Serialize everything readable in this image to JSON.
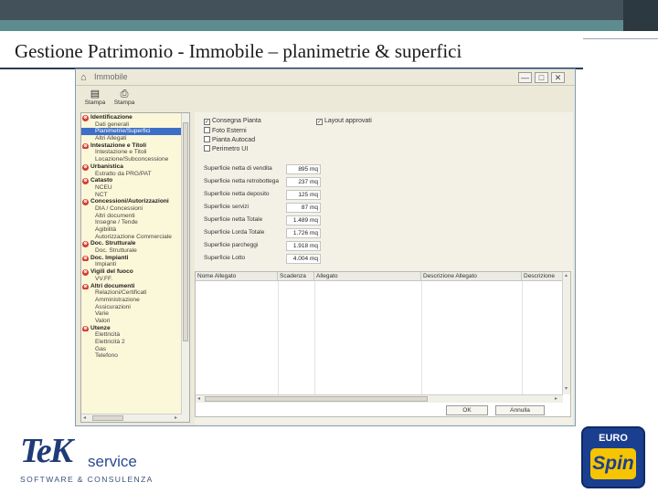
{
  "slide": {
    "title": "Gestione Patrimonio - Immobile – planimetrie & superfici"
  },
  "window": {
    "title": "Immobile",
    "controls": {
      "minimize": "—",
      "maximize": "□",
      "close": "✕"
    }
  },
  "toolbar": {
    "items": [
      {
        "label": "Stampa",
        "icon": "printer-icon"
      },
      {
        "label": "Stampa",
        "icon": "print-preview-icon"
      }
    ]
  },
  "tree": {
    "items": [
      {
        "label": "Identificazione",
        "type": "category"
      },
      {
        "label": "Dati generali",
        "type": "child"
      },
      {
        "label": "Planimetrie/Superfici",
        "type": "child",
        "selected": true
      },
      {
        "label": "Altri Allegati",
        "type": "child"
      },
      {
        "label": "Intestazione e Titoli",
        "type": "category"
      },
      {
        "label": "Intestazione e Titoli",
        "type": "child"
      },
      {
        "label": "Locazione/Subconcessione",
        "type": "child"
      },
      {
        "label": "Urbanistica",
        "type": "category"
      },
      {
        "label": "Estratto da PRG/PAT",
        "type": "child"
      },
      {
        "label": "Catasto",
        "type": "category"
      },
      {
        "label": "NCEU",
        "type": "child"
      },
      {
        "label": "NCT",
        "type": "child"
      },
      {
        "label": "Concessioni/Autorizzazioni",
        "type": "category"
      },
      {
        "label": "DIA / Concessioni",
        "type": "child"
      },
      {
        "label": "Altri documenti",
        "type": "child"
      },
      {
        "label": "Insegne / Tende",
        "type": "child"
      },
      {
        "label": "Agibilità",
        "type": "child"
      },
      {
        "label": "Autorizzazione Commerciale",
        "type": "child"
      },
      {
        "label": "Doc. Strutturale",
        "type": "category"
      },
      {
        "label": "Doc. Strutturale",
        "type": "child"
      },
      {
        "label": "Doc. Impianti",
        "type": "category"
      },
      {
        "label": "Impianti",
        "type": "child"
      },
      {
        "label": "Vigili del fuoco",
        "type": "category"
      },
      {
        "label": "VV.FF.",
        "type": "child"
      },
      {
        "label": "Altri documenti",
        "type": "category"
      },
      {
        "label": "Relazioni/Certificati",
        "type": "child"
      },
      {
        "label": "Amministrazione",
        "type": "child"
      },
      {
        "label": "Assicurazioni",
        "type": "child"
      },
      {
        "label": "Varie",
        "type": "child"
      },
      {
        "label": "Valori",
        "type": "child"
      },
      {
        "label": "Utenze",
        "type": "category"
      },
      {
        "label": "Elettricità",
        "type": "child"
      },
      {
        "label": "Elettricità 2",
        "type": "child"
      },
      {
        "label": "Gas",
        "type": "child"
      },
      {
        "label": "Telefono",
        "type": "child"
      }
    ]
  },
  "checkboxes": [
    {
      "label": "Consegna Pianta",
      "checked": true
    },
    {
      "label": "Foto Esterni",
      "checked": false
    },
    {
      "label": "Pianta Autocad",
      "checked": false
    },
    {
      "label": "Perimetro UI",
      "checked": false
    },
    {
      "label": "Layout approvati",
      "checked": true
    }
  ],
  "fields": [
    {
      "label": "Superficie netta di vendita",
      "value": "895 mq"
    },
    {
      "label": "Superficie netta retrobottega",
      "value": "237 mq"
    },
    {
      "label": "Superficie netta deposito",
      "value": "125 mq"
    },
    {
      "label": "Superficie servizi",
      "value": "87 mq"
    },
    {
      "label": "Superficie netta Totale",
      "value": "1.489 mq"
    },
    {
      "label": "Superficie Lorda Totale",
      "value": "1.726 mq"
    },
    {
      "label": "Superficie parcheggi",
      "value": "1.918 mq"
    },
    {
      "label": "Superficie Lotto",
      "value": "4.004 mq"
    }
  ],
  "grid": {
    "columns": [
      "Nome Allegato",
      "Scadenza",
      "Allegato",
      "Descrizione Allegato",
      "Descrizione"
    ]
  },
  "buttons": {
    "ok": "OK",
    "cancel": "Annulla"
  },
  "logos": {
    "tek_word": "TeK",
    "tek_service": "service",
    "tek_tagline": "SOFTWARE & CONSULENZA",
    "euro_word": "EURO",
    "spin_word": "Spin"
  },
  "colors": {
    "header_bar": "#43515a",
    "header_accent": "#5d8c8e",
    "tree_background": "#fbf7d9",
    "tree_selection": "#3d6fc6",
    "category_icon": "#d53a2e",
    "eurospin_blue": "#1a3f8f",
    "eurospin_yellow": "#f6c400"
  }
}
